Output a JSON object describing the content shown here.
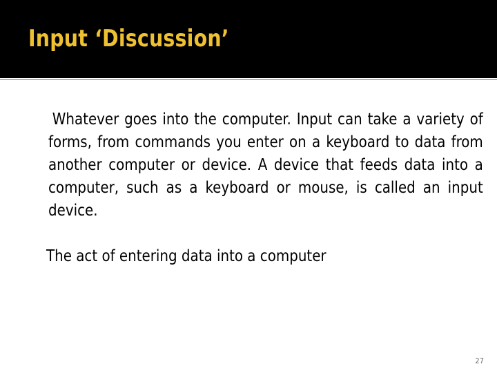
{
  "slide": {
    "title": "Input ‘Discussion’",
    "title_color": "#EFC130",
    "header_background": "#000000",
    "body_background": "#FFFFFF",
    "divider_color": "#7F7F7F",
    "body": {
      "paragraph_1": " Whatever goes into the computer. Input can take a variety of forms, from commands you enter on a keyboard to data from another computer or device. A device that feeds data into a computer, such as a keyboard or mouse, is called an input device.",
      "paragraph_2": "The act of entering data into a computer"
    },
    "page_number": "27"
  }
}
